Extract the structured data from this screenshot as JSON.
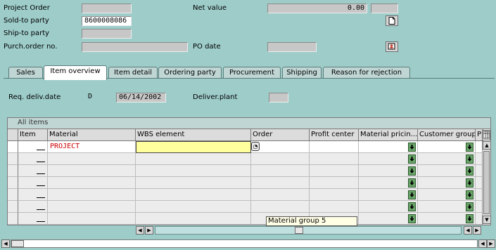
{
  "header": {
    "project_order_label": "Project Order",
    "project_order_value": "",
    "net_value_label": "Net value",
    "net_value_value": "0.00",
    "net_value_currency": "",
    "sold_to_label": "Sold-to party",
    "sold_to_value": "8600008086",
    "ship_to_label": "Ship-to party",
    "ship_to_value": "",
    "purch_order_label": "Purch.order no.",
    "purch_order_value": "",
    "po_date_label": "PO date",
    "po_date_value": ""
  },
  "icons": {
    "doc_icon": "document-icon",
    "partner_icon": "partner-details-icon"
  },
  "tabs": [
    {
      "label": "Sales"
    },
    {
      "label": "Item overview"
    },
    {
      "label": "Item detail"
    },
    {
      "label": "Ordering party"
    },
    {
      "label": "Procurement"
    },
    {
      "label": "Shipping"
    },
    {
      "label": "Reason for rejection"
    }
  ],
  "item_overview": {
    "req_deliv_label": "Req. deliv.date",
    "req_deliv_type": "D",
    "req_deliv_date": "06/14/2002",
    "deliver_plant_label": "Deliver.plant",
    "deliver_plant_value": ""
  },
  "grid": {
    "title": "All items",
    "columns": [
      "Item",
      "Material",
      "WBS element",
      "Order",
      "Profit center",
      "Material pricin...",
      "Customer group",
      "P"
    ],
    "rows": [
      {
        "item": "",
        "material": "PROJECT",
        "wbs": "",
        "order": "",
        "profit_center": ""
      },
      {
        "item": "",
        "material": "",
        "wbs": "",
        "order": "",
        "profit_center": ""
      },
      {
        "item": "",
        "material": "",
        "wbs": "",
        "order": "",
        "profit_center": ""
      },
      {
        "item": "",
        "material": "",
        "wbs": "",
        "order": "",
        "profit_center": ""
      },
      {
        "item": "",
        "material": "",
        "wbs": "",
        "order": "",
        "profit_center": ""
      },
      {
        "item": "",
        "material": "",
        "wbs": "",
        "order": "",
        "profit_center": ""
      },
      {
        "item": "",
        "material": "",
        "wbs": "",
        "order": "",
        "profit_center": ""
      }
    ],
    "tooltip": "Material group 5"
  },
  "colors": {
    "background": "#9dccc9",
    "material_text": "#cc0000",
    "active_input": "#ffff9e",
    "f4_button": "#6aa66a"
  }
}
